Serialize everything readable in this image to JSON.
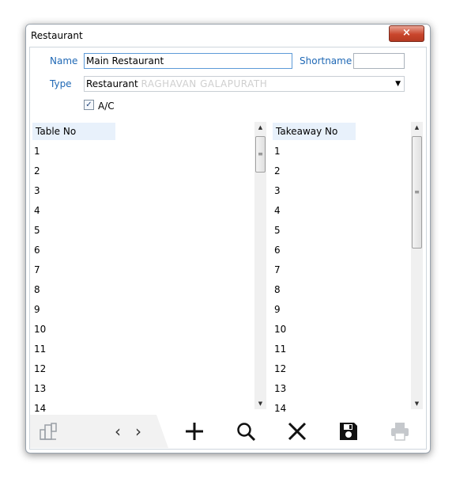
{
  "window": {
    "title": "Restaurant",
    "close_label": "×"
  },
  "form": {
    "name_label": "Name",
    "name_value": "Main Restaurant",
    "shortname_label": "Shortname",
    "shortname_value": "",
    "type_label": "Type",
    "type_value": "Restaurant",
    "type_watermark": "RAGHAVAN GALAPURATH",
    "ac_checked": true,
    "ac_label": "A/C"
  },
  "tables": {
    "header": "Table No",
    "rows": [
      "1",
      "2",
      "3",
      "4",
      "5",
      "6",
      "7",
      "8",
      "9",
      "10",
      "11",
      "12",
      "13",
      "14"
    ]
  },
  "takeaway": {
    "header": "Takeaway No",
    "rows": [
      "1",
      "2",
      "3",
      "4",
      "5",
      "6",
      "7",
      "8",
      "9",
      "10",
      "11",
      "12",
      "13",
      "14"
    ]
  },
  "toolbar": {
    "prev_label": "‹",
    "next_label": "›"
  },
  "colors": {
    "label_blue": "#1f68b5",
    "header_bg": "#e8f1fb",
    "close_red": "#c9462c"
  }
}
